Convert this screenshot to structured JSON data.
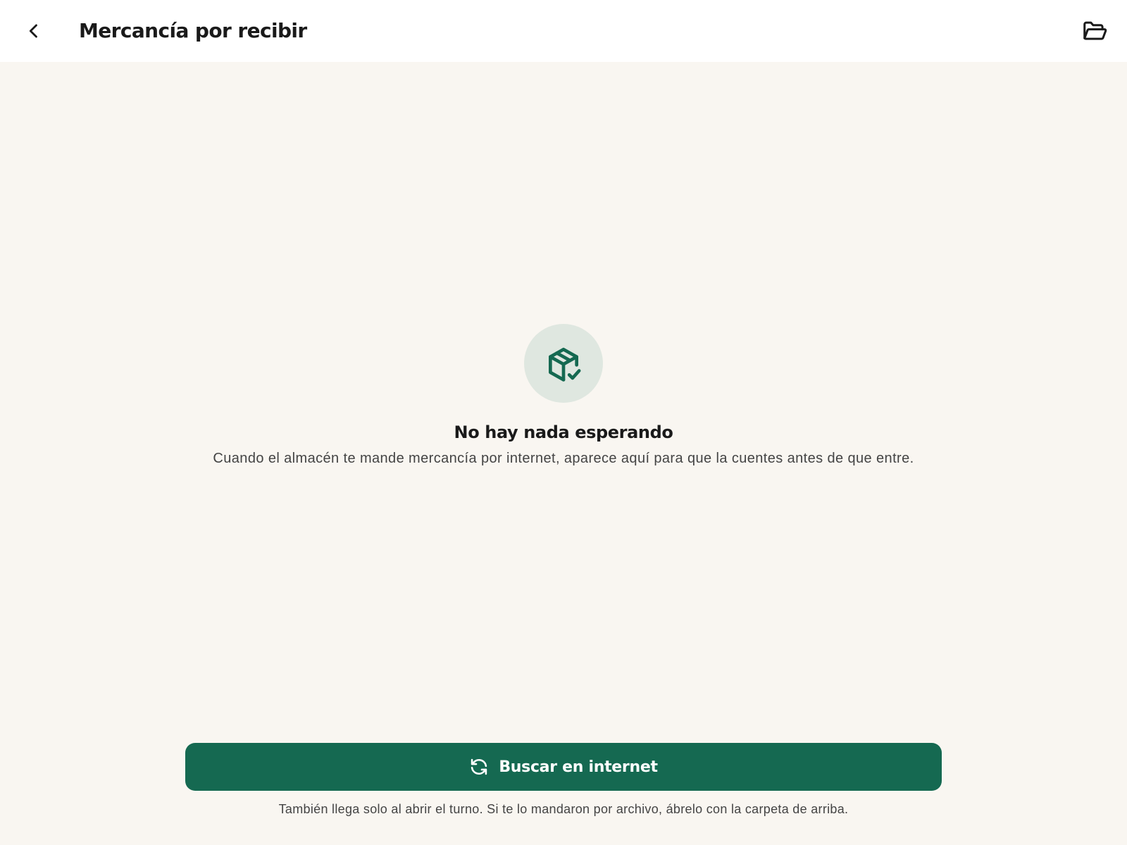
{
  "header": {
    "title": "Mercancía por recibir",
    "back_icon": "chevron-left-icon",
    "folder_icon": "folder-open-icon"
  },
  "empty_state": {
    "icon": "package-check-icon",
    "title": "No hay nada esperando",
    "description": "Cuando el almacén te mande mercancía por internet, aparece aquí para que la cuentes antes de que entre."
  },
  "actions": {
    "search_button_label": "Buscar en internet",
    "search_button_icon": "refresh-icon"
  },
  "footnote": "También llega solo al abrir el turno. Si te lo mandaron por archivo, ábrelo con la carpeta de arriba.",
  "colors": {
    "accent": "#156951",
    "icon_bg": "#dfe7e0",
    "page_bg": "#f9f6f1",
    "header_bg": "#ffffff"
  }
}
